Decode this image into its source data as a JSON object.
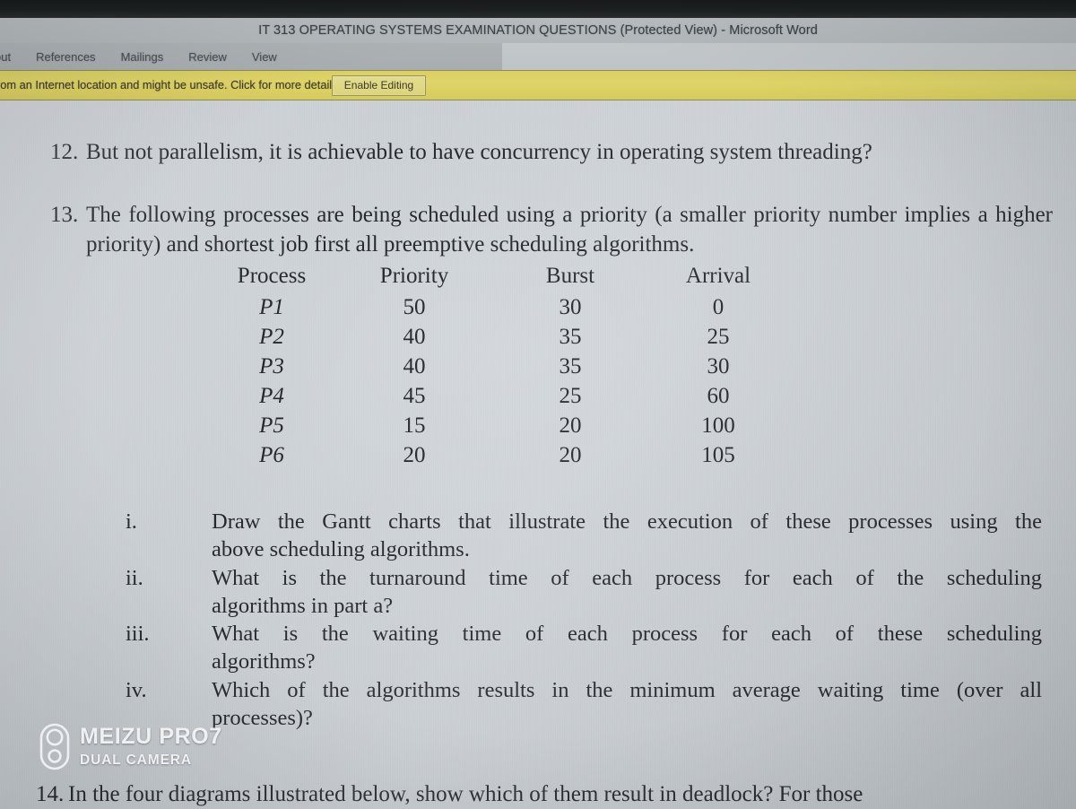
{
  "window": {
    "title": "IT 313 OPERATING SYSTEMS EXAMINATION QUESTIONS (Protected View)  -  Microsoft Word"
  },
  "ribbon": {
    "tabs": [
      {
        "label": "out"
      },
      {
        "label": "References"
      },
      {
        "label": "Mailings"
      },
      {
        "label": "Review"
      },
      {
        "label": "View"
      }
    ]
  },
  "protected_view": {
    "message": "rom an Internet location and might be unsafe. Click for more details.",
    "button_label": "Enable Editing",
    "bar_color": "#dcd468"
  },
  "document": {
    "q12": {
      "number": "12.",
      "text": "But not parallelism, it is achievable to have concurrency in operating system threading?"
    },
    "q13": {
      "number": "13.",
      "text": "The following processes are being scheduled using a priority (a smaller priority number implies a higher priority) and shortest job first all preemptive scheduling algorithms.",
      "table": {
        "headers": [
          "Process",
          "Priority",
          "Burst",
          "Arrival"
        ],
        "rows": [
          [
            "P1",
            "50",
            "30",
            "0"
          ],
          [
            "P2",
            "40",
            "35",
            "25"
          ],
          [
            "P3",
            "40",
            "35",
            "30"
          ],
          [
            "P4",
            "45",
            "25",
            "60"
          ],
          [
            "P5",
            "15",
            "20",
            "100"
          ],
          [
            "P6",
            "20",
            "20",
            "105"
          ]
        ]
      },
      "subitems": [
        {
          "marker": "i.",
          "line1": "Draw the Gantt charts that illustrate the execution of these processes using the",
          "line2": "above scheduling algorithms."
        },
        {
          "marker": "ii.",
          "line1": "What is the turnaround time of each process for each of the scheduling",
          "line2": "algorithms in part a?"
        },
        {
          "marker": "iii.",
          "line1": "What is the waiting time of each process for each of these scheduling",
          "line2": "algorithms?"
        },
        {
          "marker": "iv.",
          "line1": "Which of the algorithms results in the minimum average waiting time (over all",
          "line2": "processes)?"
        }
      ]
    },
    "q14": {
      "number": "14.",
      "text": "In the four diagrams illustrated below, show which of them result in deadlock? For those"
    }
  },
  "watermark": {
    "brand": "MEIZU PRO7",
    "subtitle": "DUAL CAMERA",
    "icon": "dual-camera-icon"
  }
}
